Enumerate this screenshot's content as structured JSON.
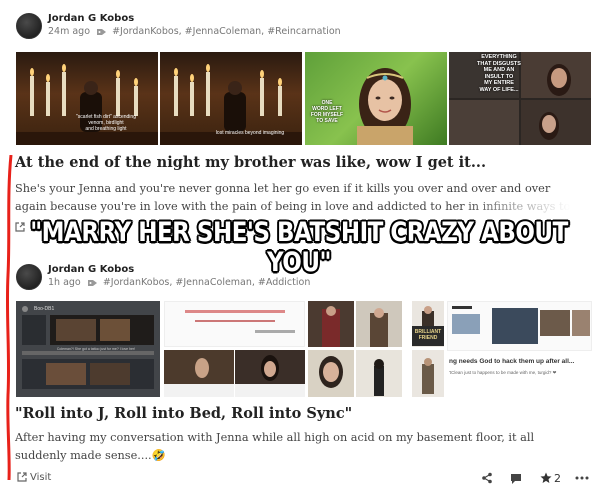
{
  "post1": {
    "author": "Jordan G Kobos",
    "time": "24m ago",
    "tags": "#JordanKobos, #JennaColeman, #Reincarnation",
    "title": "At the end of the night my brother was like, wow I get it...",
    "body": "She's your Jenna and you're never gonna let her go even if it kills you over and over and over again because you're in love with the pain of being in love and addicted to her in infinite ways to the point of",
    "thumb_captions": [
      "\"scarlet fish dirt\" ascending\nvenom, birdlight\nand breathing light",
      "lost miracles beyond imagining",
      "ONE\nWORD LEFT\nFOR MYSELF\nTO SAVE",
      "EVERYTHING\nTHAT DISGUSTS\nME AND AN\nINSULT TO\nMY ENTIRE\nWAY OF LIFE..."
    ]
  },
  "meme_text": "\"MARRY HER SHE'S BATSHIT CRAZY ABOUT YOU\"",
  "post2": {
    "author": "Jordan G Kobos",
    "time": "1h ago",
    "tags": "#JordanKobos, #JennaColeman, #Addiction",
    "title": "\"Roll into J, Roll into Bed, Roll into Sync\"",
    "body": "After having my conversation with Jenna while all high on acid on my basement floor, it all suddenly made sense....🤣",
    "thumb_texts": {
      "screenshot_title": "Boo-DB1",
      "screenshot_caption": "Coleman?! She got a tattoo just for me? I love her!",
      "ocr_line": "ng needs God to hack them up after all...",
      "ocr_sub": "'tClean just to happens to be made with me, turgid? ❤",
      "brilliant_friend": "BRILLIANT\nFRIEND"
    }
  },
  "footer": {
    "visit_label": "Visit",
    "star_count": "2"
  }
}
